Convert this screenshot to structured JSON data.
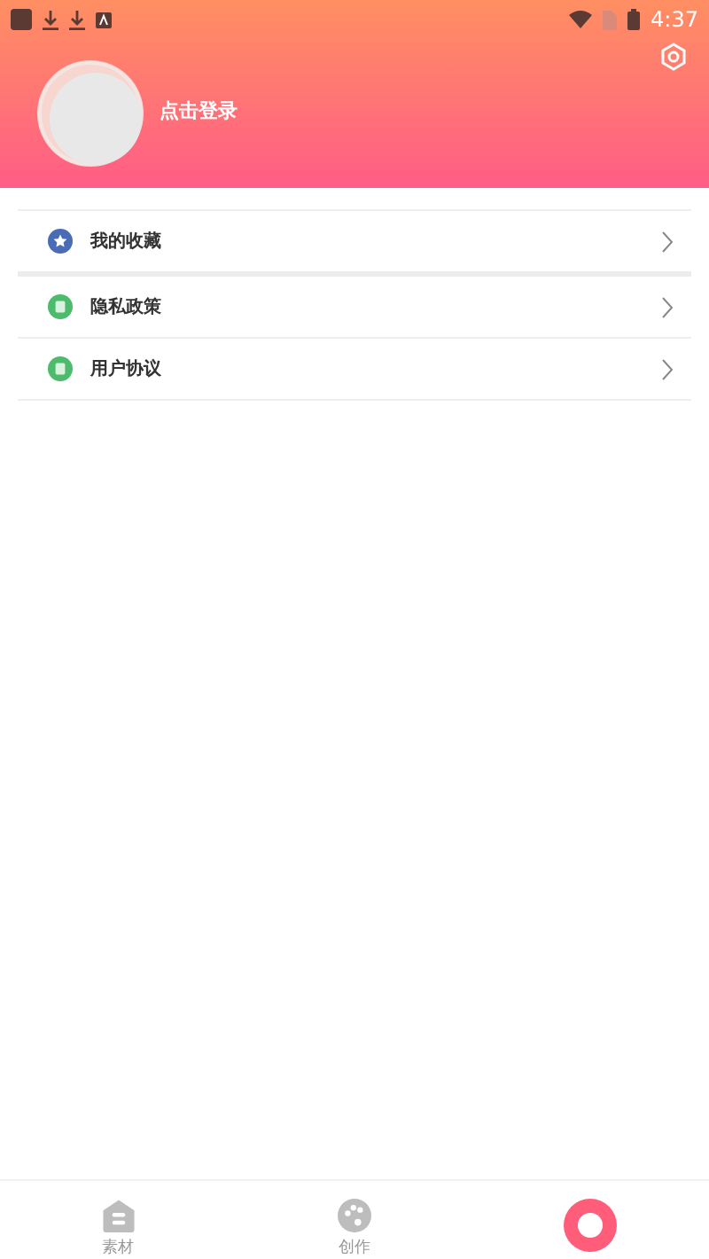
{
  "status_bar": {
    "time": "4:37"
  },
  "profile": {
    "login_label": "点击登录"
  },
  "menu": [
    {
      "label": "我的收藏",
      "color": "#4a6bb5",
      "kind": "star"
    },
    {
      "label": "隐私政策",
      "color": "#4cbb6c",
      "kind": "doc"
    },
    {
      "label": "用户协议",
      "color": "#4cbb6c",
      "kind": "doc"
    }
  ],
  "tabs": [
    {
      "label": "素材",
      "selected": false,
      "kind": "home"
    },
    {
      "label": "创作",
      "selected": false,
      "kind": "palette"
    },
    {
      "selected": true,
      "kind": "user"
    }
  ]
}
